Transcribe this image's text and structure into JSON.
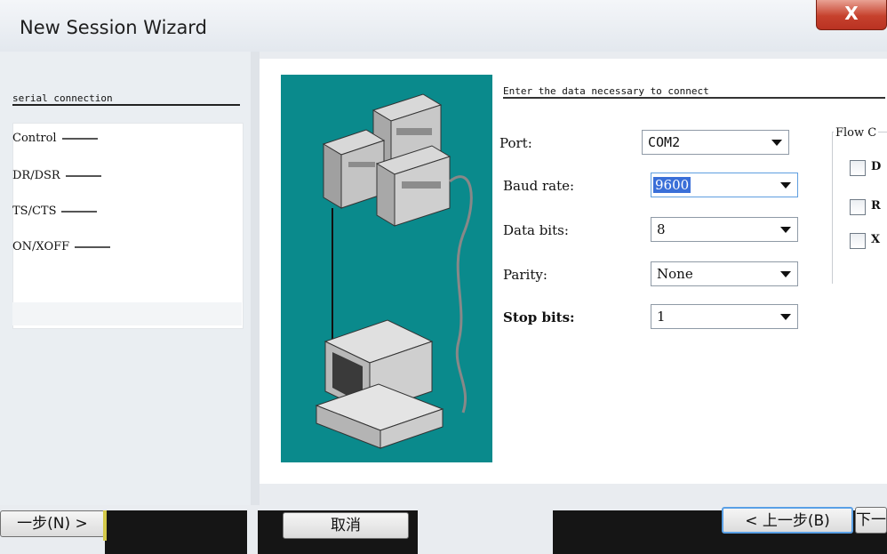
{
  "window": {
    "title": "New Session Wizard",
    "close_glyph": "X",
    "close_icon": "close-icon"
  },
  "left_page": {
    "heading": "serial connection",
    "group_label": "Control",
    "items": [
      "DR/DSR",
      "TS/CTS",
      "ON/XOFF"
    ]
  },
  "main": {
    "intro": "Enter the data necessary to connect",
    "fields": {
      "port": {
        "label": "Port:",
        "value": "COM2"
      },
      "baud": {
        "label": "Baud rate:",
        "value": "9600"
      },
      "data_bits": {
        "label": "Data bits:",
        "value": "8"
      },
      "parity": {
        "label": "Parity:",
        "value": "None"
      },
      "stop_bits": {
        "label": "Stop bits:",
        "value": "1"
      }
    },
    "flow": {
      "label": "Flow C",
      "options": [
        "D",
        "R",
        "X"
      ]
    }
  },
  "buttons": {
    "next_left": "一步(N) >",
    "cancel": "取消",
    "back": "< 上一步(B)",
    "next_right": "下一"
  }
}
